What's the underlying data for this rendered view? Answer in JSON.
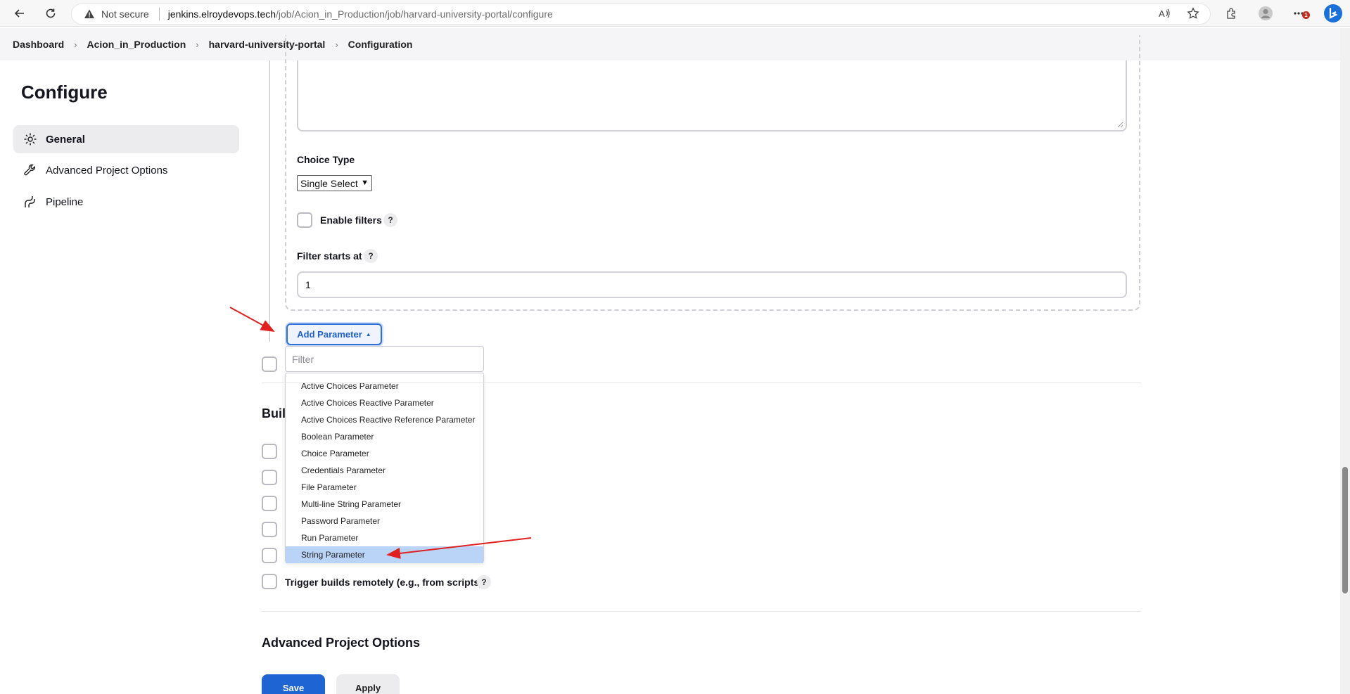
{
  "browser": {
    "security_label": "Not secure",
    "url_host": "jenkins.elroydevops.tech",
    "url_path": "/job/Acion_in_Production/job/harvard-university-portal/configure",
    "notification_count": "1"
  },
  "breadcrumb": {
    "items": [
      "Dashboard",
      "Acion_in_Production",
      "harvard-university-portal",
      "Configuration"
    ]
  },
  "sidebar": {
    "title": "Configure",
    "items": [
      {
        "label": "General",
        "icon": "gear-icon",
        "active": true
      },
      {
        "label": "Advanced Project Options",
        "icon": "wrench-icon",
        "active": false
      },
      {
        "label": "Pipeline",
        "icon": "pipeline-icon",
        "active": false
      }
    ]
  },
  "form": {
    "choice_type_label": "Choice Type",
    "choice_type_value": "Single Select",
    "enable_filters_label": "Enable filters",
    "filter_starts_label": "Filter starts at",
    "filter_starts_value": "1",
    "help_symbol": "?",
    "add_parameter_label": "Add Parameter",
    "filter_placeholder": "Filter"
  },
  "dropdown": {
    "items": [
      "Active Choices Parameter",
      "Active Choices Reactive Parameter",
      "Active Choices Reactive Reference Parameter",
      "Boolean Parameter",
      "Choice Parameter",
      "Credentials Parameter",
      "File Parameter",
      "Multi-line String Parameter",
      "Password Parameter",
      "Run Parameter",
      "String Parameter"
    ],
    "selected": "String Parameter"
  },
  "build_triggers": {
    "heading_visible": "Buil",
    "trigger_remote_label": "Trigger builds remotely (e.g., from scripts)"
  },
  "advanced": {
    "heading": "Advanced Project Options"
  },
  "actions": {
    "save_label": "Save",
    "apply_label": "Apply"
  },
  "colors": {
    "primary": "#1f64d3",
    "annotation_arrow": "#e0201f",
    "selected_item": "#b9d4f7"
  }
}
